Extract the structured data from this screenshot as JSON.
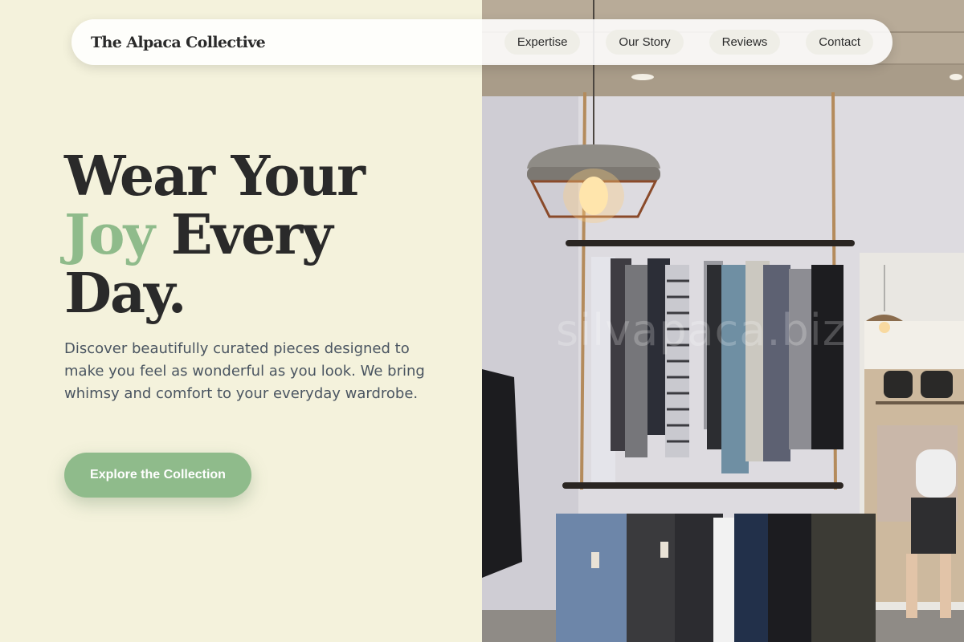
{
  "brand": {
    "name": "The Alpaca Collective"
  },
  "nav": {
    "items": [
      {
        "label": "Expertise"
      },
      {
        "label": "Our Story"
      },
      {
        "label": "Reviews"
      },
      {
        "label": "Contact"
      }
    ]
  },
  "hero": {
    "title_line1": "Wear Your",
    "title_accent": "Joy",
    "title_line2_rest": " Every",
    "title_line3": "Day.",
    "description": "Discover beautifully curated pieces designed to make you feel as wonderful as you look. We bring whimsy and comfort to your everyday wardrobe.",
    "cta_label": "Explore the Collection"
  },
  "image": {
    "watermark": "silvapaca.biz",
    "subject": "clothing-store-interior"
  },
  "colors": {
    "background": "#f4f2dc",
    "accent": "#8fbb8b",
    "text_dark": "#2a2a2a",
    "text_body": "#4a5561"
  }
}
